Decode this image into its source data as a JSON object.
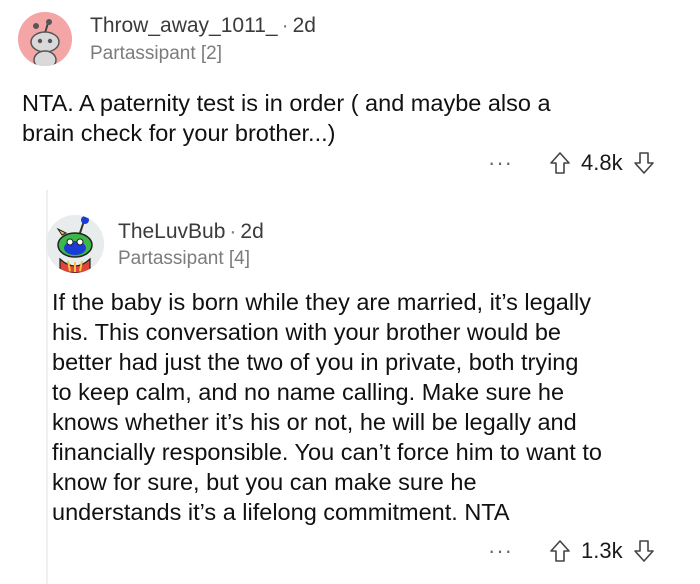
{
  "comment1": {
    "username": "Throw_away_1011_",
    "age": "2d",
    "flair": "Partassipant [2]",
    "body_lines": [
      "NTA. A paternity test is in order ( and maybe also a",
      "brain check for your brother...)"
    ],
    "score": "4.8k",
    "more_label": "···"
  },
  "comment2": {
    "username": "TheLuvBub",
    "age": "2d",
    "flair": "Partassipant [4]",
    "body_lines": [
      "If the baby is born while they are married, it’s legally",
      "his. This conversation with your brother would be",
      "better had just the two of you in private, both trying",
      "to keep calm, and no name calling. Make sure he",
      "knows whether it’s his or not, he will be legally and",
      "financially responsible. You can’t force him to want to",
      "know for sure, but you can make sure he",
      "understands it’s a lifelong commitment. NTA"
    ],
    "score": "1.3k",
    "more_label": "···"
  },
  "colors": {
    "avatar1_bg": "#f4a6a6",
    "avatar2_bg": "#e9ecec",
    "text": "#1a1a1b",
    "muted": "#7c7c7c"
  }
}
